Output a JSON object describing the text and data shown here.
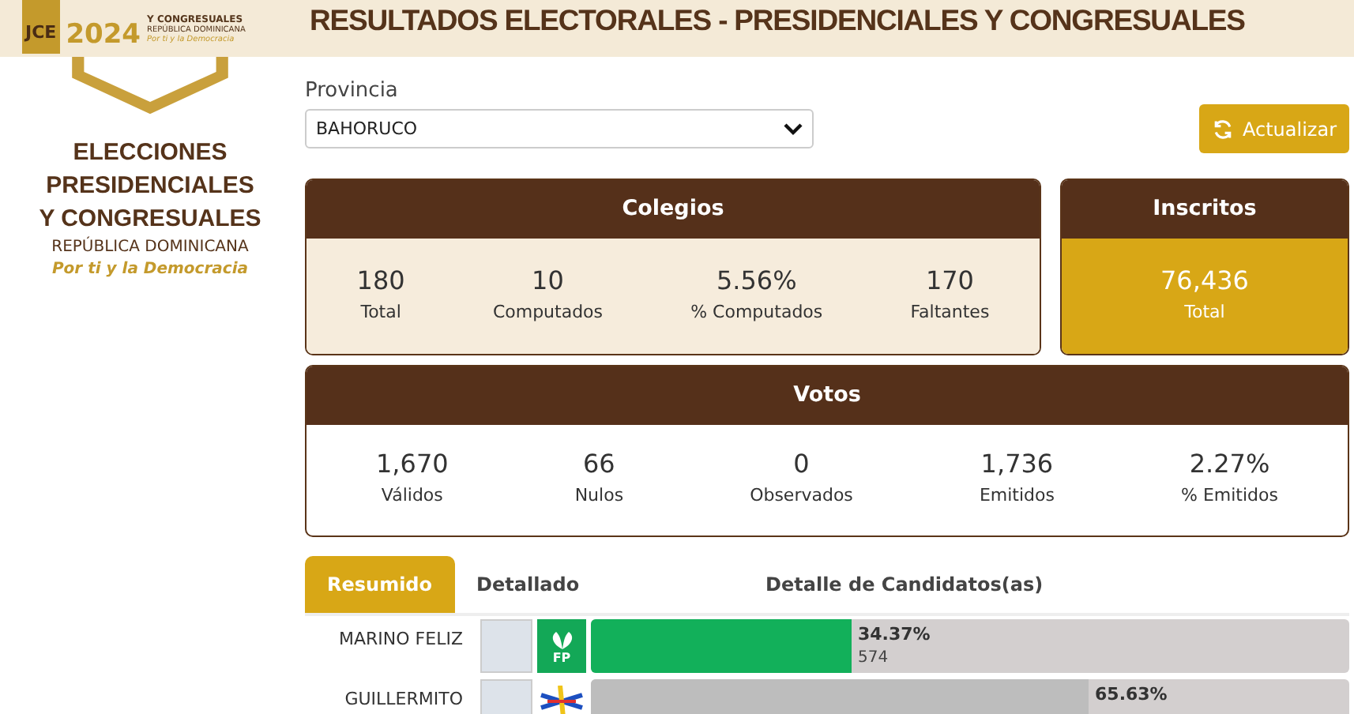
{
  "header": {
    "logo_text": "JCE",
    "year": "2024",
    "mini_title": "Y CONGRESUALES",
    "mini_country": "REPÚBLICA DOMINICANA",
    "mini_slogan": "Por ti y la Democracia",
    "title": "RESULTADOS ELECTORALES - PRESIDENCIALES Y CONGRESUALES"
  },
  "sidebar": {
    "title_lines": [
      "ELECCIONES",
      "PRESIDENCIALES",
      "Y CONGRESUALES"
    ],
    "country": "REPÚBLICA DOMINICANA",
    "slogan": "Por ti y la Democracia"
  },
  "filter": {
    "label": "Provincia",
    "value": "BAHORUCO",
    "button": "Actualizar"
  },
  "colegios": {
    "title": "Colegios",
    "stats": [
      {
        "value": "180",
        "label": "Total"
      },
      {
        "value": "10",
        "label": "Computados"
      },
      {
        "value": "5.56%",
        "label": "% Computados"
      },
      {
        "value": "170",
        "label": "Faltantes"
      }
    ]
  },
  "inscritos": {
    "title": "Inscritos",
    "value": "76,436",
    "label": "Total"
  },
  "votos": {
    "title": "Votos",
    "stats": [
      {
        "value": "1,670",
        "label": "Válidos"
      },
      {
        "value": "66",
        "label": "Nulos"
      },
      {
        "value": "0",
        "label": "Observados"
      },
      {
        "value": "1,736",
        "label": "Emitidos"
      },
      {
        "value": "2.27%",
        "label": "% Emitidos"
      }
    ]
  },
  "tabs": [
    {
      "label": "Resumido",
      "selected": true
    },
    {
      "label": "Detallado",
      "selected": false
    }
  ],
  "candidates_title": "Detalle de Candidatos(as)",
  "candidates": [
    {
      "name": "MARINO FELIZ",
      "party": "FP",
      "level": 0.3437,
      "percent": "34.37%",
      "votes": "574",
      "color": "#12b05a"
    },
    {
      "name": "GUILLERMITO",
      "level": 0.6563,
      "percent": "65.63%",
      "color": "#bdbdbd"
    }
  ]
}
